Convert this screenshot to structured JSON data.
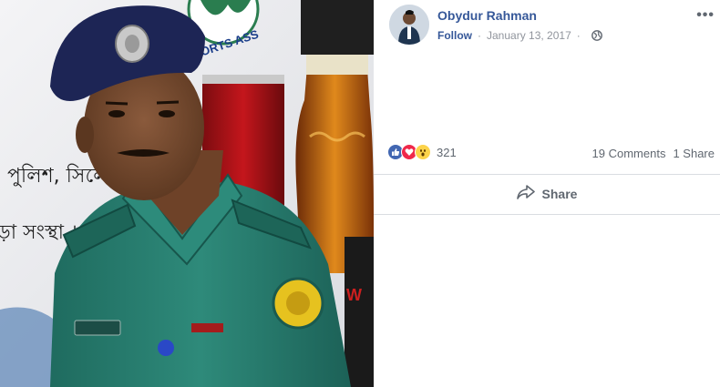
{
  "post": {
    "author": "Obydur Rahman",
    "follow_label": "Follow",
    "date": "January 13, 2017",
    "privacy_icon": "globe-icon",
    "more_icon": "more-options-icon",
    "more_label": "•••"
  },
  "photo": {
    "banner_text_1": "পুলিশ, সিলে",
    "banner_text_2": "ড়া সংস্থা ।",
    "banner_text_top": "ORTS ASS"
  },
  "engagement": {
    "reaction_icons": [
      "like-icon",
      "love-icon",
      "wow-icon"
    ],
    "reaction_count": "321",
    "comments": "19 Comments",
    "shares": "1 Share"
  },
  "actions": {
    "share_label": "Share",
    "share_icon": "share-arrow-icon"
  },
  "colors": {
    "link": "#365899",
    "muted": "#606770",
    "like": "#4267b2",
    "love": "#f0284a",
    "wow": "#fcd34a"
  }
}
